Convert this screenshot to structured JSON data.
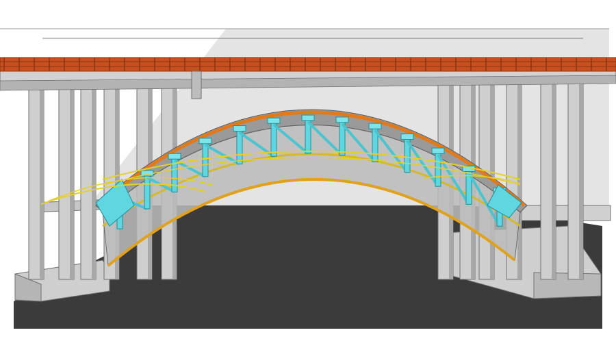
{
  "image": {
    "subject": "arch-bridge-construction-render",
    "colors": {
      "background": "#ffffff",
      "backdrop": "#e2e2e2",
      "ground": "#3a3a3a",
      "concrete": "#d3d3d3",
      "concrete_dark": "#a9a9a9",
      "concrete_edge": "#6f6f6f",
      "railing": "#c8501f",
      "railing_dark": "#8a3412",
      "arch_orange": "#e07a1c",
      "arch_gray": "#8e8e8e",
      "steel_cyan": "#5fd6e0",
      "cable_yellow": "#e3cf2e"
    },
    "icons": [
      "bridge-deck",
      "arch-span",
      "cyan-truss-frames",
      "yellow-cables",
      "concrete-piers"
    ]
  }
}
